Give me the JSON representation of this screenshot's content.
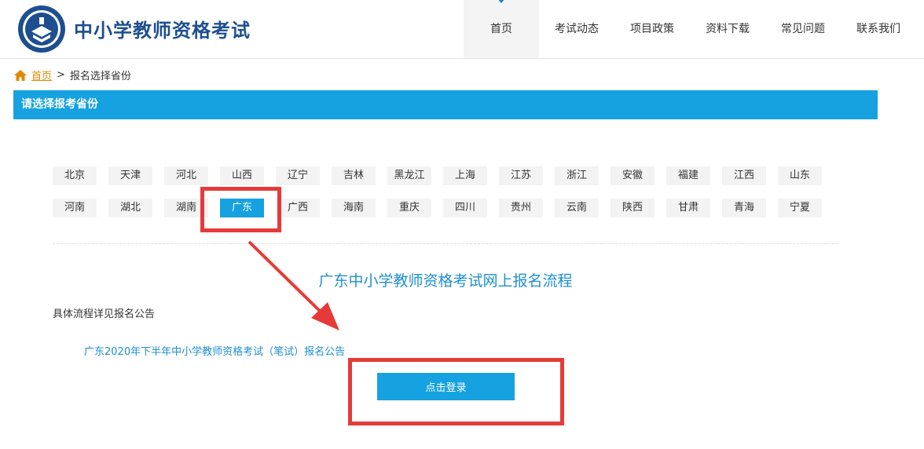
{
  "header": {
    "site_title": "中小学教师资格考试",
    "nav": [
      {
        "label": "首页",
        "active": true
      },
      {
        "label": "考试动态"
      },
      {
        "label": "项目政策"
      },
      {
        "label": "资料下载"
      },
      {
        "label": "常见问题"
      },
      {
        "label": "联系我们"
      }
    ]
  },
  "breadcrumb": {
    "home": "首页",
    "separator": ">",
    "current": "报名选择省份"
  },
  "section": {
    "title": "请选择报考省份"
  },
  "provinces": [
    "北京",
    "天津",
    "河北",
    "山西",
    "辽宁",
    "吉林",
    "黑龙江",
    "上海",
    "江苏",
    "浙江",
    "安徽",
    "福建",
    "江西",
    "山东",
    "河南",
    "湖北",
    "湖南",
    "广东",
    "广西",
    "海南",
    "重庆",
    "四川",
    "贵州",
    "云南",
    "陕西",
    "甘肃",
    "青海",
    "宁夏"
  ],
  "selected_province": "广东",
  "flow": {
    "title": "广东中小学教师资格考试网上报名流程",
    "detail_label": "具体流程详见报名公告",
    "notice_link": "广东2020年下半年中小学教师资格考试（笔试）报名公告",
    "login_button": "点击登录"
  },
  "colors": {
    "accent": "#16a2e0",
    "title_blue": "#1d4f8f",
    "link_blue": "#1d8fd0",
    "breadcrumb_link": "#e08a00",
    "annotation_red": "#e63a3a"
  }
}
